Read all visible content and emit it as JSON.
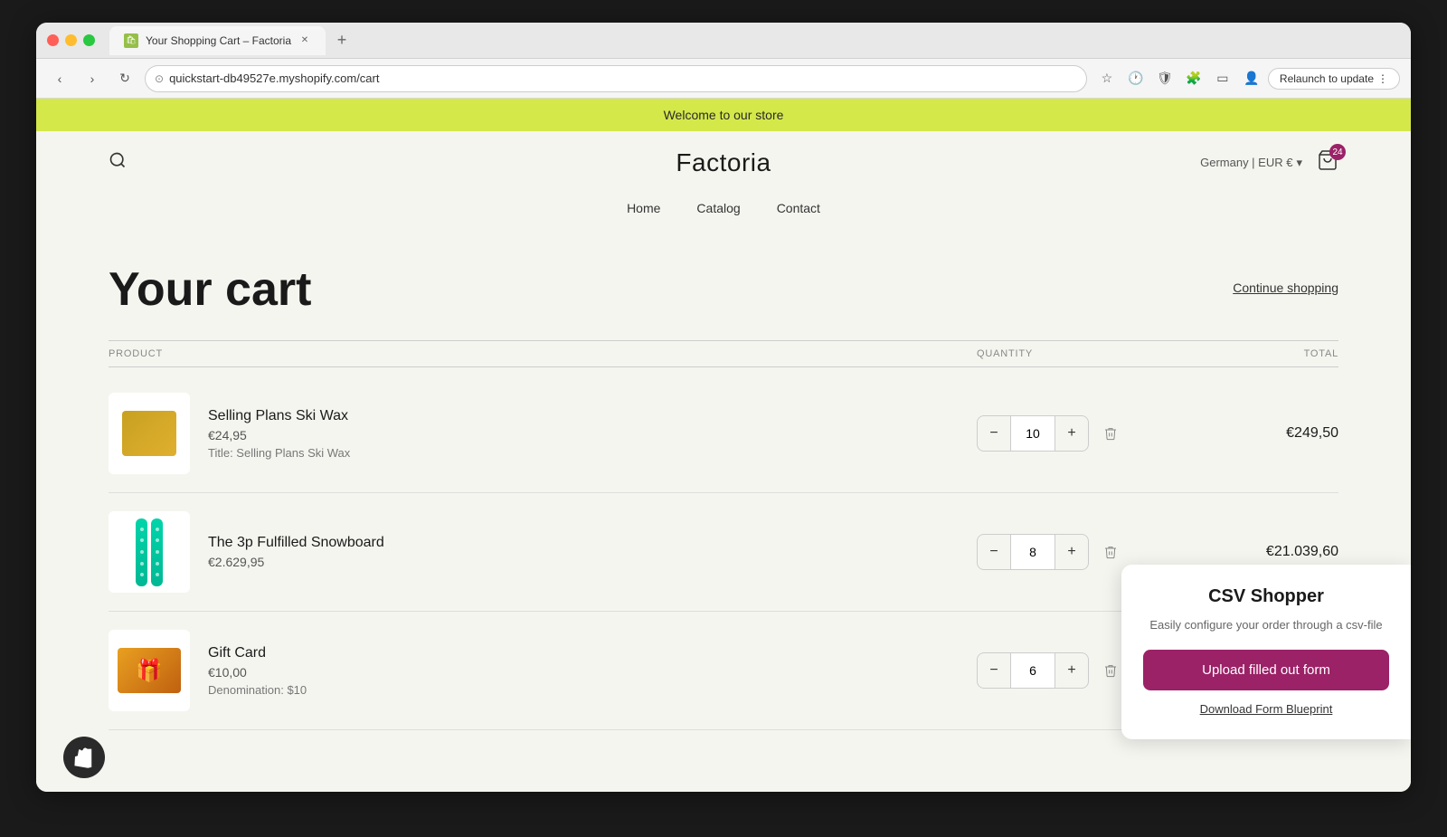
{
  "browser": {
    "tab_title": "Your Shopping Cart – Factoria",
    "address": "quickstart-db49527e.myshopify.com/cart",
    "relaunch_label": "Relaunch to update"
  },
  "banner": {
    "text": "Welcome to our store"
  },
  "header": {
    "store_name": "Factoria",
    "currency": "Germany | EUR €",
    "cart_count": "24"
  },
  "nav": {
    "items": [
      {
        "label": "Home"
      },
      {
        "label": "Catalog"
      },
      {
        "label": "Contact"
      }
    ]
  },
  "cart": {
    "title": "Your cart",
    "continue_shopping": "Continue shopping",
    "columns": {
      "product": "PRODUCT",
      "quantity": "QUANTITY",
      "total": "TOTAL"
    },
    "items": [
      {
        "name": "Selling Plans Ski Wax",
        "price": "€24,95",
        "variant": "Title: Selling Plans Ski Wax",
        "quantity": 10,
        "total": "€249,50",
        "image_type": "ski-wax"
      },
      {
        "name": "The 3p Fulfilled Snowboard",
        "price": "€2.629,95",
        "variant": null,
        "quantity": 8,
        "total": "€21.039,60",
        "image_type": "snowboard"
      },
      {
        "name": "Gift Card",
        "price": "€10,00",
        "variant": "Denomination: $10",
        "quantity": 6,
        "total": null,
        "image_type": "gift-card"
      }
    ]
  },
  "csv_popup": {
    "title": "CSV Shopper",
    "description": "Easily configure your order through a csv-file",
    "upload_label": "Upload filled out form",
    "download_label": "Download Form Blueprint"
  }
}
